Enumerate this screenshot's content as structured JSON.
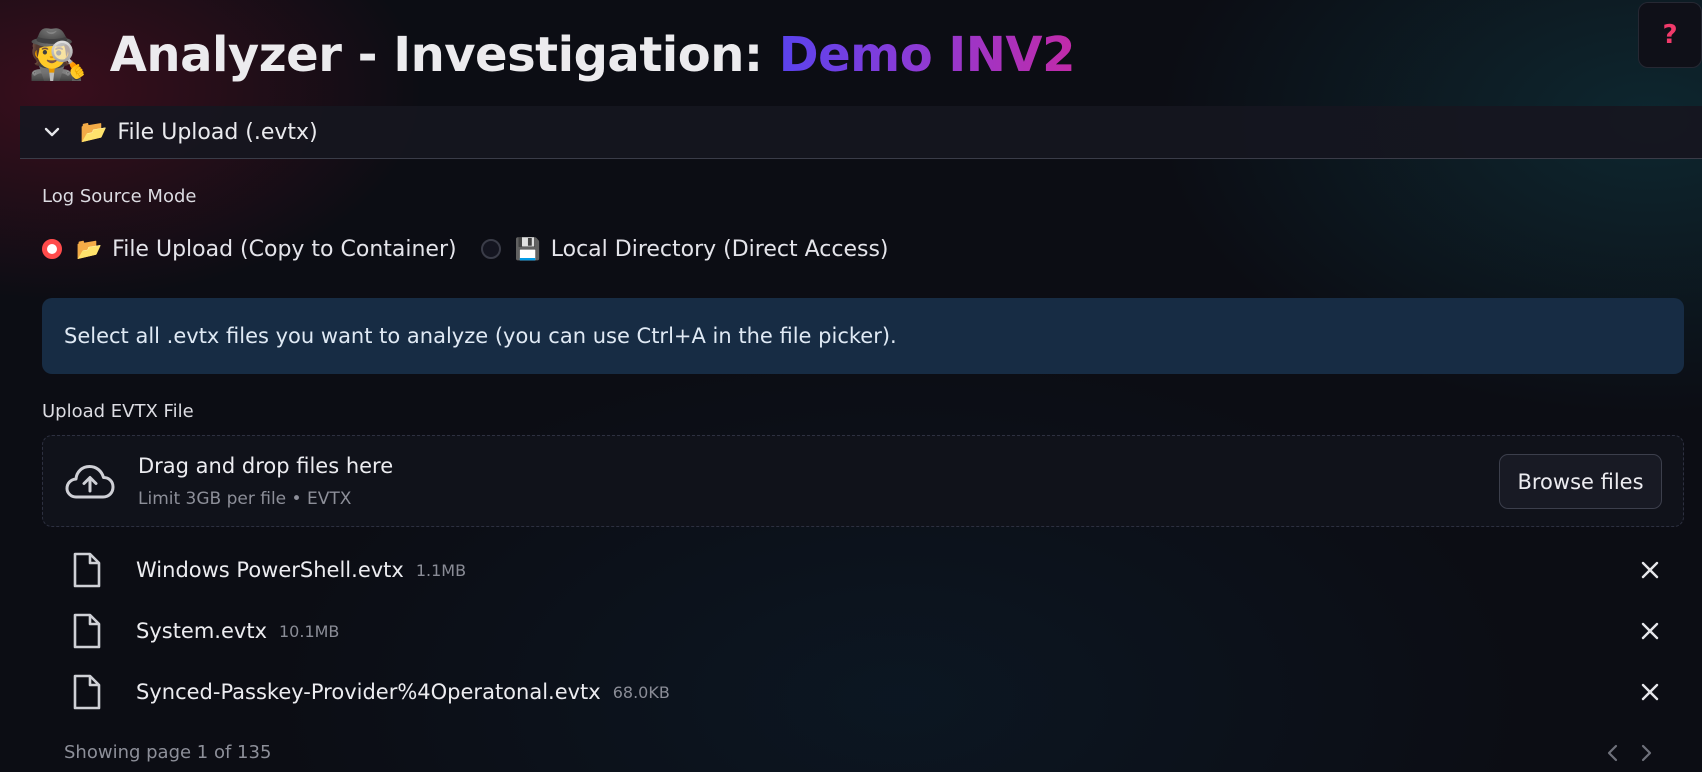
{
  "header": {
    "emoji": "🕵️",
    "title_prefix": "Analyzer - Investigation: ",
    "investigation_name": "Demo INV2",
    "help_label": "?"
  },
  "expander": {
    "icon": "chevron-down-icon",
    "emoji": "📂",
    "label": "File Upload (.evtx)"
  },
  "log_source": {
    "label": "Log Source Mode",
    "options": [
      {
        "emoji": "📂",
        "label": "File Upload (Copy to Container)",
        "selected": true
      },
      {
        "emoji": "💾",
        "label": "Local Directory (Direct Access)",
        "selected": false
      }
    ]
  },
  "info": {
    "text": "Select all .evtx files you want to analyze (you can use Ctrl+A in the file picker)."
  },
  "uploader": {
    "label": "Upload EVTX File",
    "drop_title": "Drag and drop files here",
    "drop_subtitle": "Limit 3GB per file • EVTX",
    "browse_label": "Browse files",
    "files": [
      {
        "name": "Windows PowerShell.evtx",
        "size": "1.1MB"
      },
      {
        "name": "System.evtx",
        "size": "10.1MB"
      },
      {
        "name": "Synced-Passkey-Provider%4Operatonal.evtx",
        "size": "68.0KB"
      }
    ],
    "pagination": "Showing page 1 of 135"
  },
  "colors": {
    "accent_red": "#ff4b4b",
    "gradient_start": "#5a43ee",
    "gradient_end": "#c22aa8",
    "info_bg": "#172c44",
    "help_mark": "#f03a6a"
  }
}
